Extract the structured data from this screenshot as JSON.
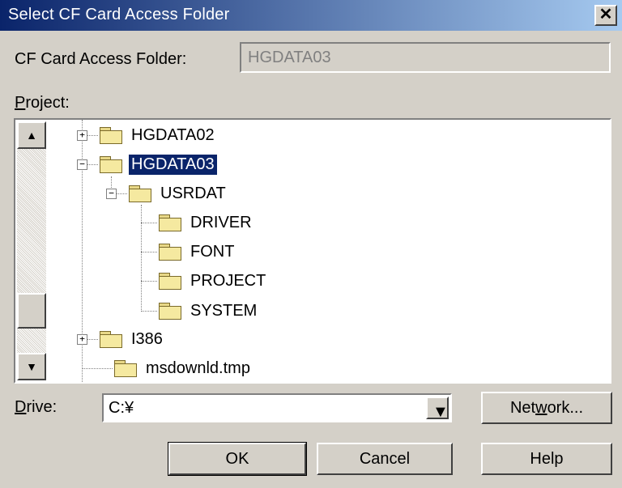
{
  "window": {
    "title": "Select CF Card Access Folder",
    "close_glyph": "✕"
  },
  "access_folder": {
    "label": "CF Card Access Folder:",
    "value": "HGDATA03"
  },
  "project": {
    "label_accel": "P",
    "label_rest": "roject:"
  },
  "tree": {
    "items": [
      {
        "label": "HGDATA02",
        "expander": "+"
      },
      {
        "label": "HGDATA03",
        "expander": "−",
        "selected": true
      },
      {
        "label": "USRDAT",
        "expander": "−"
      },
      {
        "label": "DRIVER"
      },
      {
        "label": "FONT"
      },
      {
        "label": "PROJECT"
      },
      {
        "label": "SYSTEM"
      },
      {
        "label": "I386",
        "expander": "+"
      },
      {
        "label": "msdownld.tmp"
      }
    ]
  },
  "scrollbar": {
    "up_glyph": "▲",
    "down_glyph": "▼"
  },
  "drive": {
    "label_accel": "D",
    "label_rest": "rive:",
    "value": "C:¥",
    "dropdown_glyph": "▼"
  },
  "buttons": {
    "network_pre": "Net",
    "network_accel": "w",
    "network_post": "ork...",
    "ok": "OK",
    "cancel": "Cancel",
    "help": "Help"
  }
}
